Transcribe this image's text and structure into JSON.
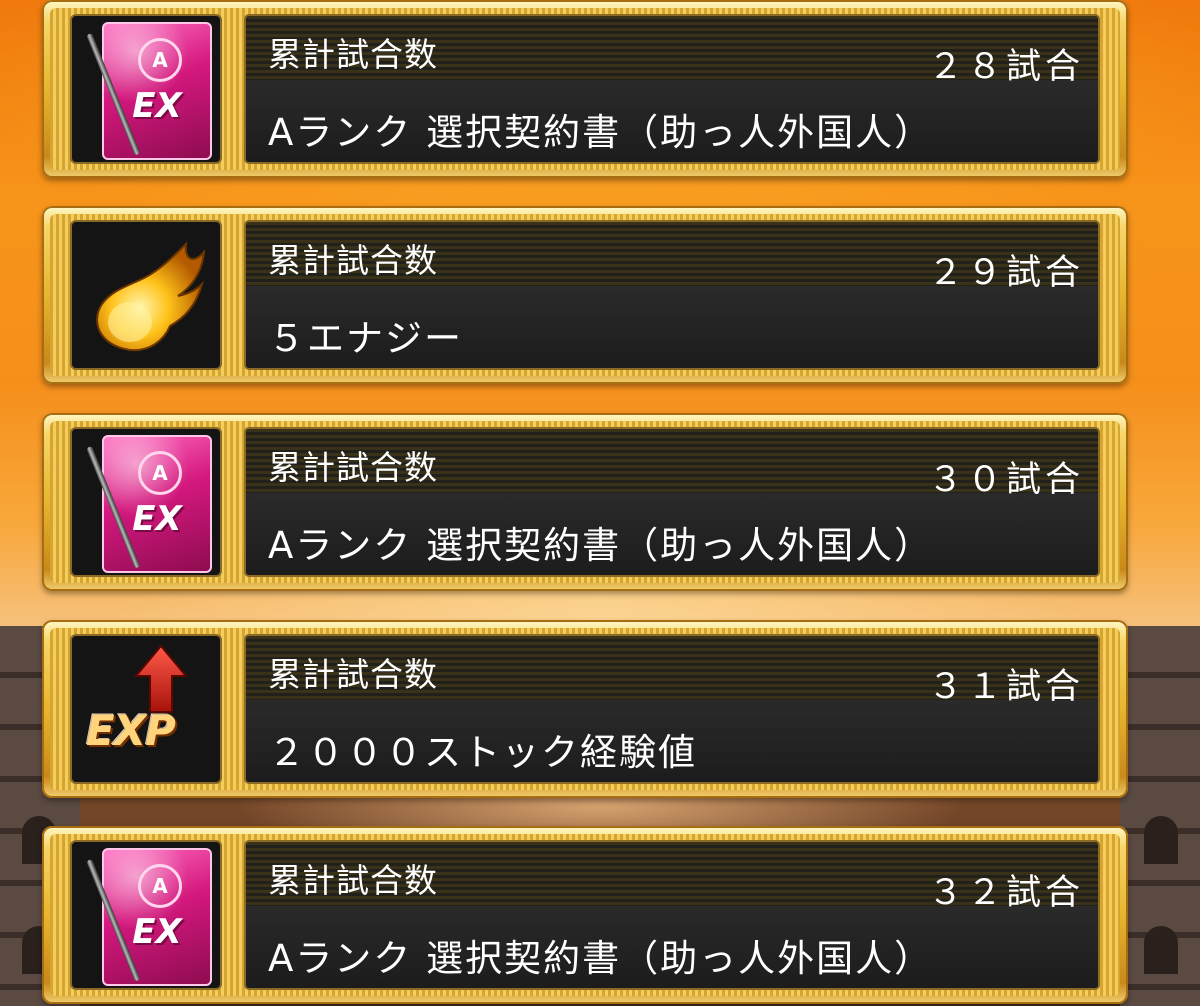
{
  "rewards": [
    {
      "label": "累計試合数",
      "count": "２８試合",
      "reward": "Aランク 選択契約書（助っ人外国人）",
      "icon": "contract-icon",
      "icon_text": "EX",
      "emblem_text": "A"
    },
    {
      "label": "累計試合数",
      "count": "２９試合",
      "reward": "５エナジー",
      "icon": "flame-icon"
    },
    {
      "label": "累計試合数",
      "count": "３０試合",
      "reward": "Aランク 選択契約書（助っ人外国人）",
      "icon": "contract-icon",
      "icon_text": "EX",
      "emblem_text": "A"
    },
    {
      "label": "累計試合数",
      "count": "３１試合",
      "reward": "２０００ストック経験値",
      "icon": "exp-up-icon",
      "icon_text": "EXP"
    },
    {
      "label": "累計試合数",
      "count": "３２試合",
      "reward": "Aランク 選択契約書（助っ人外国人）",
      "icon": "contract-icon",
      "icon_text": "EX",
      "emblem_text": "A"
    }
  ],
  "colors": {
    "background": "#f7951a",
    "frame_gold": "#e7b52e",
    "panel_dark": "#1a1a1a",
    "contract_pink": "#d4187e",
    "text": "#ffffff"
  }
}
